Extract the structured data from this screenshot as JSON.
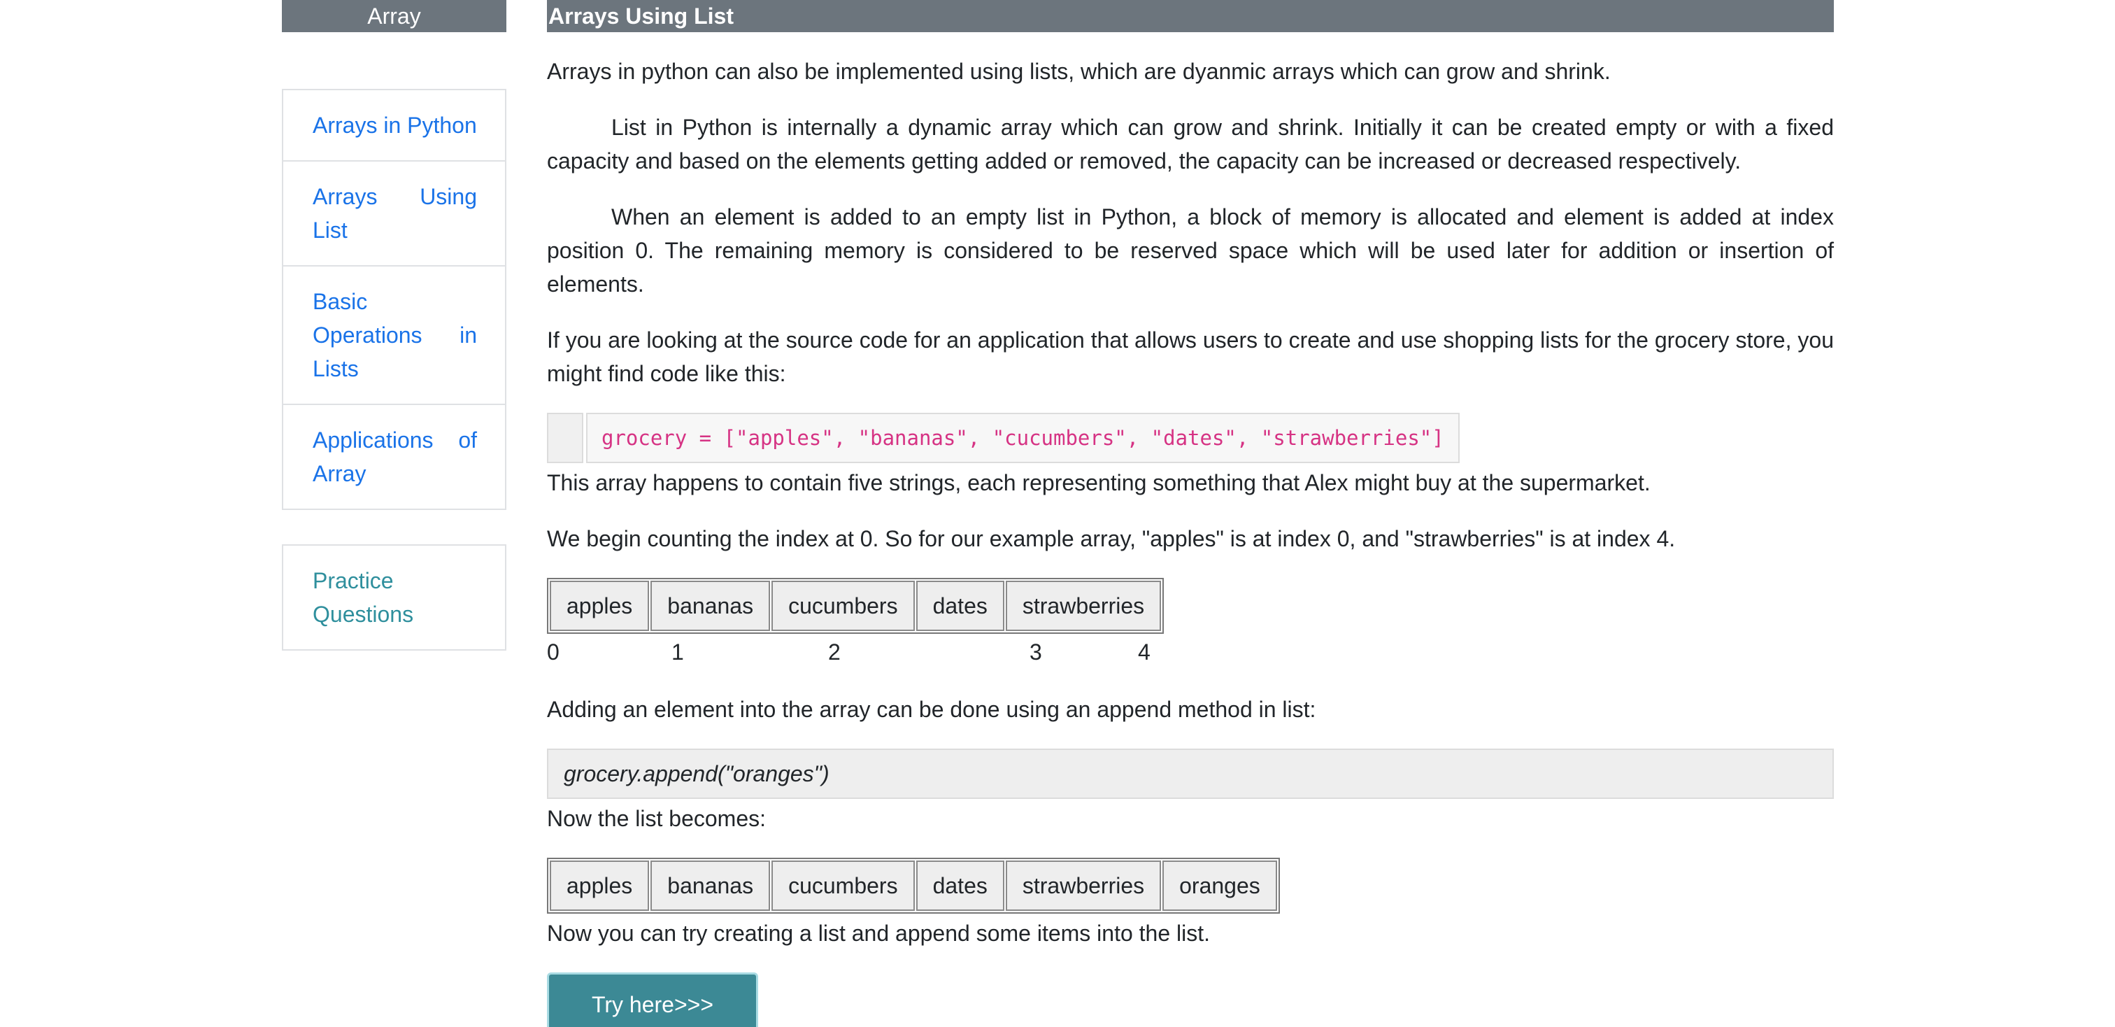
{
  "sidebar": {
    "header": "Array",
    "items": [
      {
        "label": "Arrays in Python"
      },
      {
        "label": "Arrays Using List"
      },
      {
        "label": "Basic Operations in Lists"
      },
      {
        "label": "Applications of Array"
      }
    ],
    "practice": "Practice Questions"
  },
  "main": {
    "title": "Arrays Using List",
    "p1": "Arrays in python can also be implemented using lists, which are dyanmic arrays which can grow and shrink.",
    "p2": "List in Python is internally a dynamic array which can grow and shrink. Initially it can be created empty or with a fixed capacity and based on the elements getting added or removed, the capacity can be increased or decreased respectively.",
    "p3": "When an element is added to an empty list in Python, a block of memory is allocated and element is added at index position 0. The remaining memory is considered to be reserved space which will be used later for addition or insertion of elements.",
    "p4": "If you are looking at the source code for an application that allows users to create and use shopping lists for the grocery store, you might find code like this:",
    "code": "grocery = [\"apples\", \"bananas\", \"cucumbers\", \"dates\", \"strawberries\"]",
    "p5": "This array happens to contain five strings, each representing something that Alex might buy at the supermarket.",
    "p6": "We begin counting the index at 0. So for our example array, \"apples\" is at index 0, and \"strawberries\" is at index 4.",
    "array1": [
      "apples",
      "bananas",
      "cucumbers",
      "dates",
      "strawberries"
    ],
    "indices": [
      "0",
      "1",
      "2",
      "3",
      "4"
    ],
    "p7": "Adding an element into the array can be done using an  append method in list:",
    "append_code": "grocery.append(\"oranges\")",
    "p8": "Now the list becomes:",
    "array2": [
      "apples",
      "bananas",
      "cucumbers",
      "dates",
      "strawberries",
      "oranges"
    ],
    "p9": "Now you can try creating a list and append some items into the list.",
    "try_button": "Try here>>>"
  }
}
